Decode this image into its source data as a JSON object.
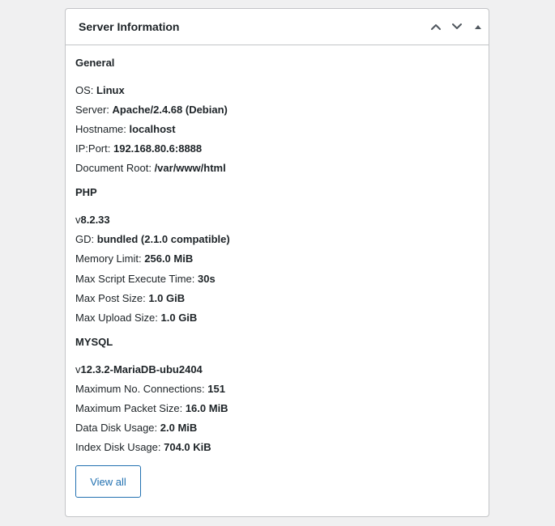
{
  "widget": {
    "title": "Server Information",
    "controls": {
      "move_up": "chevron-up-icon",
      "move_down": "chevron-down-icon",
      "toggle": "triangle-up-icon"
    }
  },
  "general": {
    "heading": "General",
    "os_label": "OS:",
    "os_value": "Linux",
    "server_label": "Server:",
    "server_value": "Apache/2.4.68 (Debian)",
    "hostname_label": "Hostname:",
    "hostname_value": "localhost",
    "ipport_label": "IP:Port:",
    "ipport_value": "192.168.80.6:8888",
    "docroot_label": "Document Root:",
    "docroot_value": "/var/www/html"
  },
  "php": {
    "heading": "PHP",
    "version_prefix": "v",
    "version_value": "8.2.33",
    "gd_label": "GD:",
    "gd_value": "bundled (2.1.0 compatible)",
    "memory_label": "Memory Limit:",
    "memory_value": "256.0 MiB",
    "exec_label": "Max Script Execute Time:",
    "exec_value": "30s",
    "post_label": "Max Post Size:",
    "post_value": "1.0 GiB",
    "upload_label": "Max Upload Size:",
    "upload_value": "1.0 GiB"
  },
  "mysql": {
    "heading": "MYSQL",
    "version_prefix": "v",
    "version_value": "12.3.2-MariaDB-ubu2404",
    "connections_label": "Maximum No. Connections:",
    "connections_value": "151",
    "packet_label": "Maximum Packet Size:",
    "packet_value": "16.0 MiB",
    "data_disk_label": "Data Disk Usage:",
    "data_disk_value": "2.0 MiB",
    "index_disk_label": "Index Disk Usage:",
    "index_disk_value": "704.0 KiB"
  },
  "actions": {
    "view_all": "View all"
  },
  "colors": {
    "accent": "#2271b1",
    "text": "#1d2327",
    "border": "#c3c4c7",
    "background": "#f0f0f1"
  }
}
